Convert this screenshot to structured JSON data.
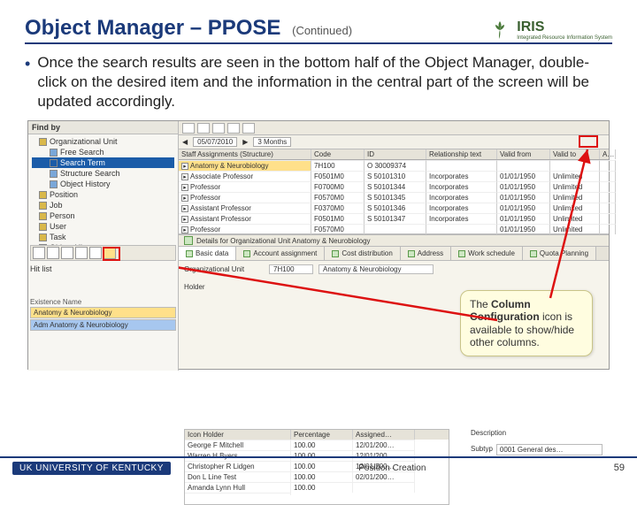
{
  "header": {
    "title": "Object Manager – PPOSE",
    "continued": "(Continued)",
    "logo_text": "IRIS",
    "logo_sub": "Integrated Resource Information System"
  },
  "bullet_text": "Once the search results are seen in the bottom half of the Object Manager, double-click on the desired item and the information in the central part of the screen will be updated accordingly.",
  "tree": {
    "header": "Find by",
    "items": [
      {
        "label": "Organizational Unit",
        "lvl": 1,
        "icon": "org"
      },
      {
        "label": "Free Search",
        "lvl": 2,
        "icon": "blue"
      },
      {
        "label": "Search Term",
        "lvl": 2,
        "icon": "sel",
        "selected": true
      },
      {
        "label": "Structure Search",
        "lvl": 2,
        "icon": "blue"
      },
      {
        "label": "Object History",
        "lvl": 2,
        "icon": "blue"
      },
      {
        "label": "Position",
        "lvl": 1,
        "icon": "org"
      },
      {
        "label": "Job",
        "lvl": 1,
        "icon": "org"
      },
      {
        "label": "Person",
        "lvl": 1,
        "icon": "org"
      },
      {
        "label": "User",
        "lvl": 1,
        "icon": "org"
      },
      {
        "label": "Task",
        "lvl": 1,
        "icon": "org"
      },
      {
        "label": "Object History",
        "lvl": 1,
        "icon": "blue"
      }
    ],
    "hitlist_label": "Hit list",
    "existence_label": "Existence Name",
    "hits": [
      {
        "text": "Anatomy & Neurobiology",
        "hl": true
      },
      {
        "text": "Adm Anatomy & Neurobiology",
        "sel": true
      }
    ]
  },
  "datebar": {
    "arrow_l": "◀",
    "arrow_r": "▶",
    "date": "05/07/2010",
    "span": "3 Months"
  },
  "grid": {
    "headers": [
      "Staff Assignments (Structure)",
      "Code",
      "ID",
      "Relationship text",
      "Valid from",
      "Valid to",
      "A…"
    ],
    "rows": [
      {
        "c": [
          "Anatomy & Neurobiology",
          "7H100",
          "O 30009374",
          "",
          "",
          "",
          ""
        ],
        "hl": true
      },
      {
        "c": [
          "Associate Professor",
          "F0501M0",
          "S 50101310",
          "Incorporates",
          "01/01/1950",
          "Unlimited",
          ""
        ]
      },
      {
        "c": [
          "Professor",
          "F0700M0",
          "S 50101344",
          "Incorporates",
          "01/01/1950",
          "Unlimited",
          ""
        ]
      },
      {
        "c": [
          "Professor",
          "F0570M0",
          "S 50101345",
          "Incorporates",
          "01/01/1950",
          "Unlimited",
          ""
        ]
      },
      {
        "c": [
          "Assistant Professor",
          "F0370M0",
          "S 50101346",
          "Incorporates",
          "01/01/1950",
          "Unlimited",
          ""
        ]
      },
      {
        "c": [
          "Assistant Professor",
          "F0501M0",
          "S 50101347",
          "Incorporates",
          "01/01/1950",
          "Unlimited",
          ""
        ]
      },
      {
        "c": [
          "Professor",
          "F0570M0",
          "",
          "",
          "01/01/1950",
          "Unlimited",
          ""
        ]
      }
    ]
  },
  "details_bar": "Details for Organizational Unit Anatomy & Neurobiology",
  "tabs": [
    "Basic data",
    "Account assignment",
    "Cost distribution",
    "Address",
    "Work schedule",
    "Quota Planning"
  ],
  "detail": {
    "lbl1": "Organizational Unit",
    "code": "7H100",
    "name": "Anatomy & Neurobiology",
    "holder_lbl": "Holder",
    "holder_headers": [
      "Icon Holder",
      "Percentage",
      "Assigned…"
    ],
    "holders": [
      {
        "c": [
          "George F Mitchell",
          "100.00",
          "12/01/200…"
        ]
      },
      {
        "c": [
          "Warren H Byers",
          "100.00",
          "12/01/200…"
        ]
      },
      {
        "c": [
          "Christopher R Lidgen",
          "100.00",
          "12/01/200…"
        ]
      },
      {
        "c": [
          "Don L Line Test",
          "100.00",
          "02/01/200…"
        ]
      },
      {
        "c": [
          "Amanda Lynn Hull",
          "100.00",
          "",
          ""
        ]
      }
    ],
    "desc_lbl": "Description",
    "subtyp_lbl": "Subtyp",
    "subtyp_val": "0001 General des…"
  },
  "callout": {
    "pre": "The ",
    "bold": "Column Configuration",
    "post": " icon is available to show/hide other columns."
  },
  "footer": {
    "uk": "UK UNIVERSITY OF KENTUCKY",
    "title": "Position Creation",
    "page": "59"
  }
}
